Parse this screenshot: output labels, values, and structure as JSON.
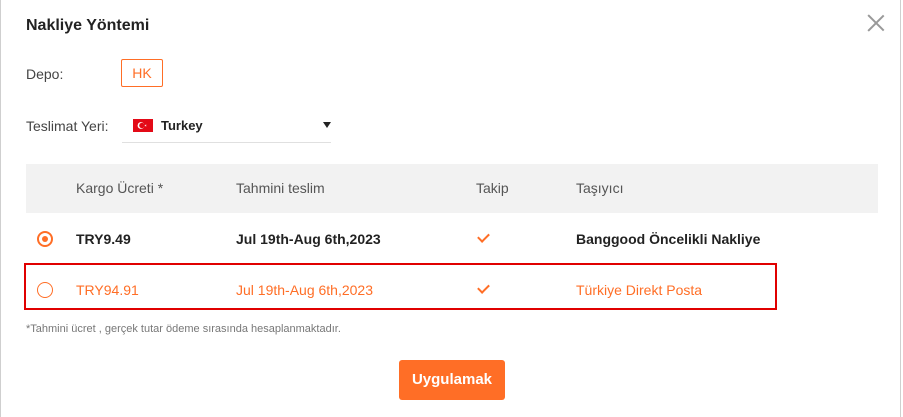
{
  "dialog": {
    "title": "Nakliye Yöntemi"
  },
  "warehouse": {
    "label": "Depo:",
    "value": "HK"
  },
  "destination": {
    "label": "Teslimat Yeri:",
    "country": "Turkey",
    "flag_icon": "turkey-flag-icon"
  },
  "table": {
    "headers": [
      "Kargo Ücreti *",
      "Tahmini teslim",
      "Takip",
      "Taşıyıcı"
    ],
    "rows": [
      {
        "selected": true,
        "price": "TRY9.49",
        "delivery": "Jul 19th-Aug 6th,2023",
        "tracking": true,
        "carrier": "Banggood Öncelikli Nakliye"
      },
      {
        "selected": false,
        "price": "TRY94.91",
        "delivery": "Jul 19th-Aug 6th,2023",
        "tracking": true,
        "carrier": "Türkiye Direkt Posta"
      }
    ]
  },
  "note": "*Tahmini ücret , gerçek tutar ödeme sırasında hesaplanmaktadır.",
  "apply_button": "Uygulamak",
  "colors": {
    "accent": "#ff6e26",
    "highlight_border": "#e00000",
    "header_bg": "#f2f2f2"
  }
}
